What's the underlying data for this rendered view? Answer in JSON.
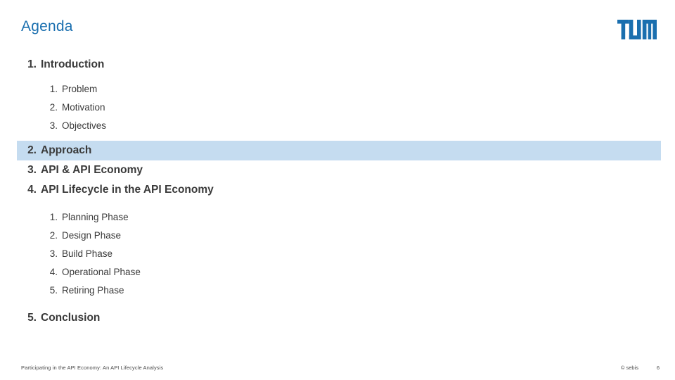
{
  "slide": {
    "title": "Agenda",
    "logo_icon": "tum-logo-icon",
    "logo_alt": "TUM",
    "brand_color": "#1a6faf",
    "highlight_color": "#c5dcf0",
    "text_color": "#3a3a3a"
  },
  "agenda": {
    "items": [
      {
        "number": "1.",
        "label": "Introduction",
        "highlighted": false,
        "subitems": [
          {
            "number": "1.",
            "label": "Problem"
          },
          {
            "number": "2.",
            "label": "Motivation"
          },
          {
            "number": "3.",
            "label": "Objectives"
          }
        ]
      },
      {
        "number": "2.",
        "label": "Approach",
        "highlighted": true,
        "subitems": []
      },
      {
        "number": "3.",
        "label": "API & API Economy",
        "highlighted": false,
        "subitems": []
      },
      {
        "number": "4.",
        "label": "API Lifecycle in the API Economy",
        "highlighted": false,
        "subitems": [
          {
            "number": "1.",
            "label": "Planning Phase"
          },
          {
            "number": "2.",
            "label": "Design Phase"
          },
          {
            "number": "3.",
            "label": "Build Phase"
          },
          {
            "number": "4.",
            "label": "Operational Phase"
          },
          {
            "number": "5.",
            "label": "Retiring Phase"
          }
        ]
      },
      {
        "number": "5.",
        "label": "Conclusion",
        "highlighted": false,
        "subitems": []
      }
    ]
  },
  "footer": {
    "left_text": "Participating in the API Economy: An API Lifecycle Analysis",
    "copyright": "© sebis",
    "page_number": "6"
  }
}
